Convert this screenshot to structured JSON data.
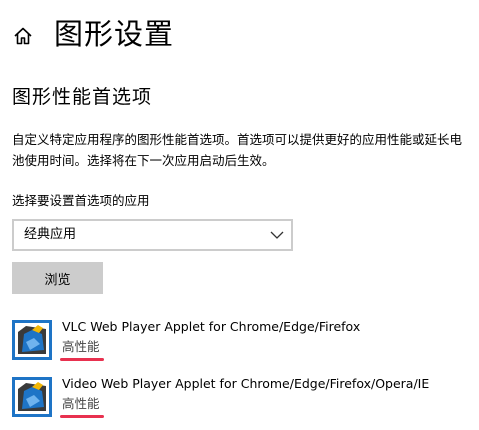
{
  "header": {
    "home_icon": "home-icon",
    "title": "图形设置"
  },
  "section": {
    "title": "图形性能首选项",
    "description": "自定义特定应用程序的图形性能首选项。首选项可以提供更好的应用性能或延长电池使用时间。选择将在下一次应用启动后生效。"
  },
  "selector": {
    "label": "选择要设置首选项的应用",
    "value": "经典应用",
    "chevron_icon": "chevron-down-icon"
  },
  "browse_button": {
    "label": "浏览"
  },
  "apps": [
    {
      "name": "VLC Web Player Applet for Chrome/Edge/Firefox",
      "preference": "高性能",
      "icon": "app-icon"
    },
    {
      "name": "Video Web Player Applet for Chrome/Edge/Firefox/Opera/IE",
      "preference": "高性能",
      "icon": "app-icon"
    }
  ],
  "colors": {
    "accent_underline": "#e8314f",
    "icon_blue": "#1e74c6",
    "icon_dark": "#3a3a3a",
    "icon_yellow": "#f2b705",
    "dropdown_border": "#cccccc",
    "button_bg": "#cccccc"
  }
}
